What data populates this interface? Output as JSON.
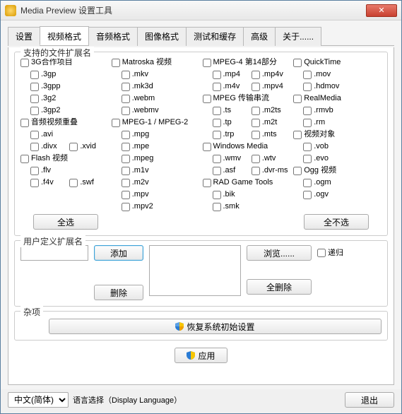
{
  "window": {
    "title": "Media Preview 设置工具",
    "close_x": "✕"
  },
  "tabs": [
    "设置",
    "视频格式",
    "音频格式",
    "图像格式",
    "测试和缓存",
    "高级",
    "关于......"
  ],
  "active_tab_index": 1,
  "ext_group": {
    "title": "支持的文件扩展名"
  },
  "columns": [
    {
      "blocks": [
        {
          "head": "3G合作项目",
          "rows": [
            [
              {
                "t": ".3gp"
              }
            ],
            [
              {
                "t": ".3gpp"
              }
            ],
            [
              {
                "t": ".3g2"
              }
            ],
            [
              {
                "t": ".3gp2"
              }
            ]
          ]
        },
        {
          "head": "音频视频重叠",
          "rows": [
            [
              {
                "t": ".avi"
              }
            ],
            [
              {
                "t": ".divx"
              },
              {
                "t": ".xvid"
              }
            ]
          ]
        },
        {
          "head": "Flash 视频",
          "rows": [
            [
              {
                "t": ".flv"
              }
            ],
            [
              {
                "t": ".f4v"
              },
              {
                "t": ".swf"
              }
            ]
          ]
        }
      ]
    },
    {
      "blocks": [
        {
          "head": "Matroska 视频",
          "rows": [
            [
              {
                "t": ".mkv"
              }
            ],
            [
              {
                "t": ".mk3d"
              }
            ],
            [
              {
                "t": ".webm"
              }
            ],
            [
              {
                "t": ".webmv"
              }
            ]
          ]
        },
        {
          "head": "MPEG-1 / MPEG-2",
          "rows": [
            [
              {
                "t": ".mpg"
              }
            ],
            [
              {
                "t": ".mpe"
              }
            ],
            [
              {
                "t": ".mpeg"
              }
            ],
            [
              {
                "t": ".m1v"
              }
            ],
            [
              {
                "t": ".m2v"
              }
            ],
            [
              {
                "t": ".mpv"
              }
            ],
            [
              {
                "t": ".mpv2"
              }
            ]
          ]
        }
      ]
    },
    {
      "blocks": [
        {
          "head": "MPEG-4 第14部分",
          "rows": [
            [
              {
                "t": ".mp4"
              },
              {
                "t": ".mp4v"
              }
            ],
            [
              {
                "t": ".m4v"
              },
              {
                "t": ".mpv4"
              }
            ]
          ]
        },
        {
          "head": "MPEG 传输串流",
          "rows": [
            [
              {
                "t": ".ts"
              },
              {
                "t": ".m2ts"
              }
            ],
            [
              {
                "t": ".tp"
              },
              {
                "t": ".m2t"
              }
            ],
            [
              {
                "t": ".trp"
              },
              {
                "t": ".mts"
              }
            ]
          ]
        },
        {
          "head": "Windows Media",
          "rows": [
            [
              {
                "t": ".wmv"
              },
              {
                "t": ".wtv"
              }
            ],
            [
              {
                "t": ".asf"
              },
              {
                "t": ".dvr-ms"
              }
            ]
          ]
        },
        {
          "head": "RAD Game Tools",
          "rows": [
            [
              {
                "t": ".bik"
              }
            ],
            [
              {
                "t": ".smk"
              }
            ]
          ]
        }
      ]
    },
    {
      "blocks": [
        {
          "head": "QuickTime",
          "rows": [
            [
              {
                "t": ".mov"
              }
            ],
            [
              {
                "t": ".hdmov"
              }
            ]
          ]
        },
        {
          "head": "RealMedia",
          "rows": [
            [
              {
                "t": ".rmvb"
              }
            ],
            [
              {
                "t": ".rm"
              }
            ]
          ]
        },
        {
          "head": "视频对象",
          "rows": [
            [
              {
                "t": ".vob"
              }
            ],
            [
              {
                "t": ".evo"
              }
            ]
          ]
        },
        {
          "head": "Ogg 视频",
          "rows": [
            [
              {
                "t": ".ogm"
              }
            ],
            [
              {
                "t": ".ogv"
              }
            ]
          ]
        }
      ]
    }
  ],
  "select_all": "全选",
  "select_none": "全不选",
  "user_group": {
    "title": "用户定义扩展名",
    "add": "添加",
    "delete": "删除",
    "browse": "浏览......",
    "recurse": "递归",
    "delete_all": "全删除"
  },
  "misc_group": {
    "title": "杂项",
    "restore": "恢复系统初始设置"
  },
  "apply": "应用",
  "footer": {
    "lang_value": "中文(简体)",
    "lang_label": "语言选择（Display Language）",
    "exit": "退出"
  }
}
